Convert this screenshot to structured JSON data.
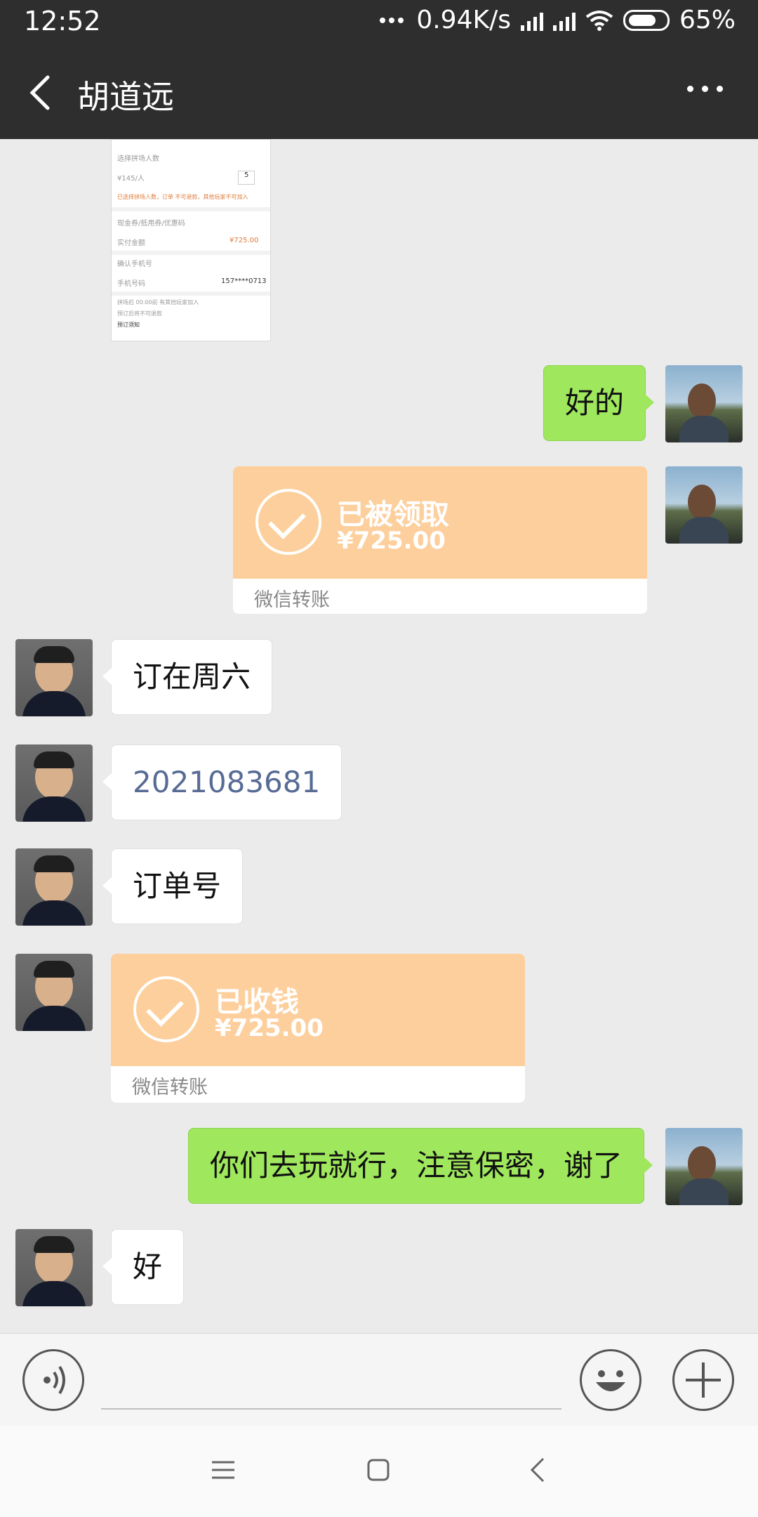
{
  "status_bar": {
    "time": "12:52",
    "network_speed": "0.94K/s",
    "battery": "65%"
  },
  "header": {
    "title": "胡道远"
  },
  "thumbnail": {
    "lines": [
      "选择拼场人数",
      "¥145/人",
      "5",
      "已选择拼场人数，订单 不可退款，其他玩家不可加入",
      "现金券/抵用券/优惠码",
      "实付金额",
      "¥725.00",
      "确认手机号",
      "手机号码",
      "157****0713",
      "拼场后 00:00前 有其他玩家加入",
      "预订后将不可退款",
      "预订须知"
    ]
  },
  "messages": [
    {
      "side": "right",
      "type": "text",
      "text": "好的"
    },
    {
      "side": "right",
      "type": "transfer",
      "status": "已被领取",
      "amount": "¥725.00",
      "label": "微信转账"
    },
    {
      "side": "left",
      "type": "text",
      "text": "订在周六"
    },
    {
      "side": "left",
      "type": "text",
      "text": "2021083681"
    },
    {
      "side": "left",
      "type": "text",
      "text": "订单号"
    },
    {
      "side": "left",
      "type": "transfer",
      "status": "已收钱",
      "amount": "¥725.00",
      "label": "微信转账"
    },
    {
      "side": "right",
      "type": "text",
      "text": "你们去玩就行，注意保密，谢了"
    },
    {
      "side": "left",
      "type": "text",
      "text": "好"
    }
  ],
  "icons": {
    "back": "back-arrow-icon",
    "more": "more-dots-icon",
    "voice": "voice-icon",
    "emoji": "emoji-icon",
    "plus": "plus-icon",
    "nav_menu": "menu-icon",
    "nav_home": "home-icon",
    "nav_back": "back-icon"
  },
  "colors": {
    "header_bg": "#2e2e2e",
    "chat_bg": "#ebebeb",
    "my_bubble": "#9fe75d",
    "transfer": "#fdcf9c",
    "link_number": "#576b95"
  }
}
